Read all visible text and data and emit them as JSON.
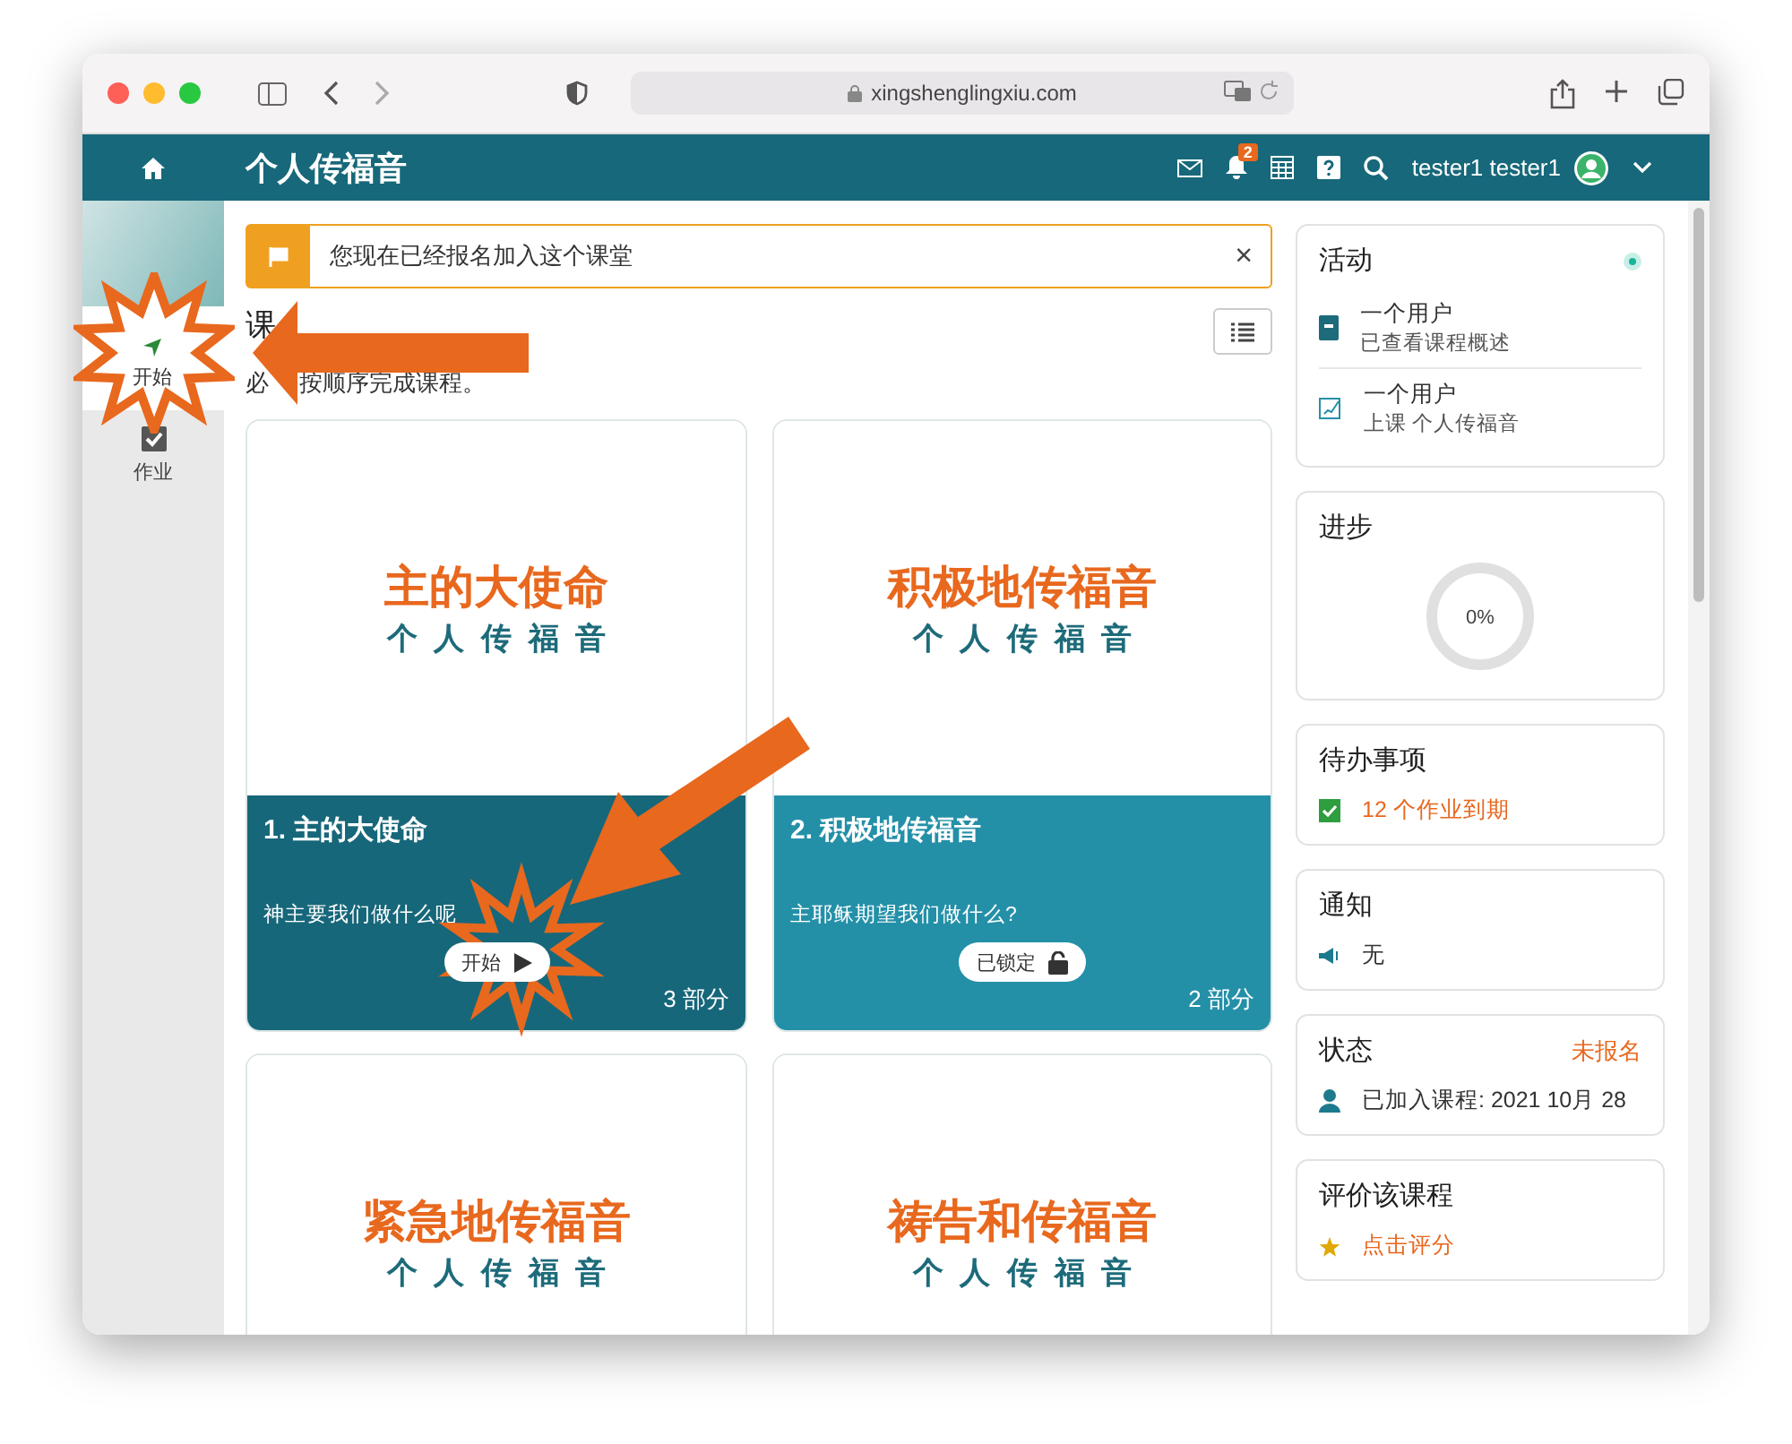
{
  "browser": {
    "url": "xingshenglingxiu.com"
  },
  "nav": {
    "title": "个人传福音",
    "notifications": "2",
    "user": "tester1 tester1"
  },
  "sidebar": {
    "items": [
      {
        "label": "开始",
        "kind": "start",
        "selected": true
      },
      {
        "label": "作业",
        "kind": "assignments",
        "selected": false
      }
    ]
  },
  "alert": {
    "text": "您现在已经报名加入这个课堂",
    "close": "×"
  },
  "section": {
    "title": "课",
    "subtitle": [
      "必",
      "按顺序完成课程。"
    ]
  },
  "courses": [
    {
      "cover_title": "主的大使命",
      "cover_subtitle": "个人传福音",
      "title": "1. 主的大使命",
      "description": "神主要我们做什么呢",
      "action": "开始",
      "locked": false,
      "parts": "3 部分"
    },
    {
      "cover_title": "积极地传福音",
      "cover_subtitle": "个人传福音",
      "title": "2. 积极地传福音",
      "description": "主耶稣期望我们做什么?",
      "action": "已锁定",
      "locked": true,
      "parts": "2 部分"
    },
    {
      "cover_title": "紧急地传福音",
      "cover_subtitle": "个人传福音"
    },
    {
      "cover_title": "祷告和传福音",
      "cover_subtitle": "个人传福音"
    }
  ],
  "activity": {
    "title": "活动",
    "items": [
      {
        "user": "一个用户",
        "action": "已查看课程概述",
        "kind": "overview"
      },
      {
        "user": "一个用户",
        "action": "上课 个人传福音",
        "kind": "lesson"
      }
    ]
  },
  "progress": {
    "title": "进步",
    "label": "0%",
    "level": 0
  },
  "todo": {
    "title": "待办事项",
    "text": "12 个作业到期"
  },
  "notices": {
    "title": "通知",
    "text": "无"
  },
  "status": {
    "title": "状态",
    "badge": "未报名",
    "text": "已加入课程: 2021 10月 28"
  },
  "rating": {
    "title": "评价该课程",
    "text": "点击评分"
  }
}
